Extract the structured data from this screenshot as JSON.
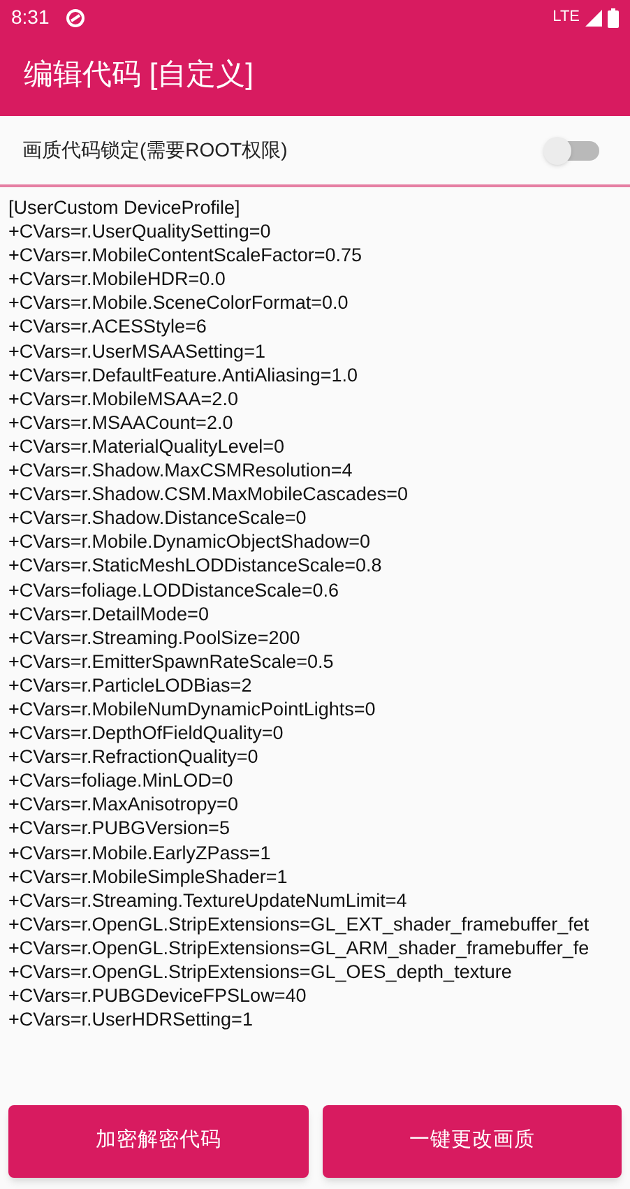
{
  "status_bar": {
    "time": "8:31",
    "network": "LTE"
  },
  "app_bar": {
    "title": "编辑代码 [自定义]"
  },
  "lock_setting": {
    "label": "画质代码锁定(需要ROOT权限)",
    "on": false
  },
  "code_editor": {
    "lines": [
      "[UserCustom DeviceProfile]",
      "+CVars=r.UserQualitySetting=0",
      "+CVars=r.MobileContentScaleFactor=0.75",
      "+CVars=r.MobileHDR=0.0",
      "+CVars=r.Mobile.SceneColorFormat=0.0",
      "+CVars=r.ACESStyle=6",
      "+CVars=r.UserMSAASetting=1",
      "+CVars=r.DefaultFeature.AntiAliasing=1.0",
      "+CVars=r.MobileMSAA=2.0",
      "+CVars=r.MSAACount=2.0",
      "+CVars=r.MaterialQualityLevel=0",
      "+CVars=r.Shadow.MaxCSMResolution=4",
      "+CVars=r.Shadow.CSM.MaxMobileCascades=0",
      "+CVars=r.Shadow.DistanceScale=0",
      "+CVars=r.Mobile.DynamicObjectShadow=0",
      "+CVars=r.StaticMeshLODDistanceScale=0.8",
      "+CVars=foliage.LODDistanceScale=0.6",
      "+CVars=r.DetailMode=0",
      "+CVars=r.Streaming.PoolSize=200",
      "+CVars=r.EmitterSpawnRateScale=0.5",
      "+CVars=r.ParticleLODBias=2",
      "+CVars=r.MobileNumDynamicPointLights=0",
      "+CVars=r.DepthOfFieldQuality=0",
      "+CVars=r.RefractionQuality=0",
      "+CVars=foliage.MinLOD=0",
      "+CVars=r.MaxAnisotropy=0",
      "+CVars=r.PUBGVersion=5",
      "+CVars=r.Mobile.EarlyZPass=1",
      "+CVars=r.MobileSimpleShader=1",
      "+CVars=r.Streaming.TextureUpdateNumLimit=4",
      "+CVars=r.OpenGL.StripExtensions=GL_EXT_shader_framebuffer_fet",
      "+CVars=r.OpenGL.StripExtensions=GL_ARM_shader_framebuffer_fe",
      "+CVars=r.OpenGL.StripExtensions=GL_OES_depth_texture",
      "+CVars=r.PUBGDeviceFPSLow=40",
      "+CVars=r.UserHDRSetting=1"
    ]
  },
  "buttons": [
    "加密解密代码",
    "一键更改画质"
  ]
}
